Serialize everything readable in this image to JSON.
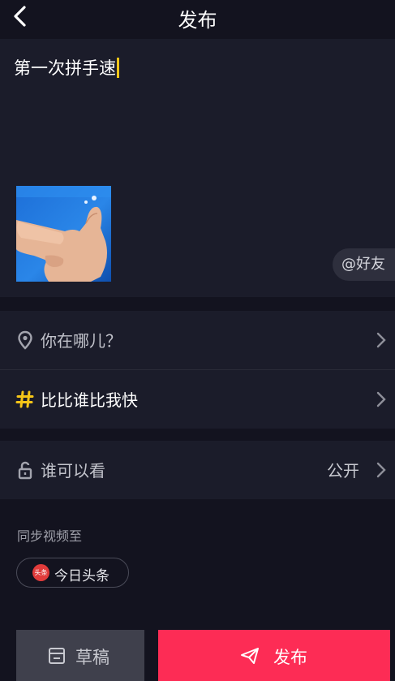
{
  "header": {
    "title": "发布",
    "back_icon": "back-arrow-icon"
  },
  "compose": {
    "caption_text": "第一次拼手速",
    "friend_button_label": "@好友"
  },
  "location_row": {
    "icon": "location-pin-icon",
    "placeholder": "你在哪儿？"
  },
  "topic_row": {
    "icon": "hashtag-icon",
    "label": "比比谁比我快",
    "icon_color": "#f5c518"
  },
  "visibility_row": {
    "icon": "unlock-icon",
    "label": "谁可以看",
    "value": "公开"
  },
  "sync": {
    "title": "同步视频至",
    "chip_label": "今日头条",
    "chip_logo_text": "头条"
  },
  "actions": {
    "draft_label": "草稿",
    "publish_label": "发布",
    "publish_color": "#fd2c55"
  }
}
